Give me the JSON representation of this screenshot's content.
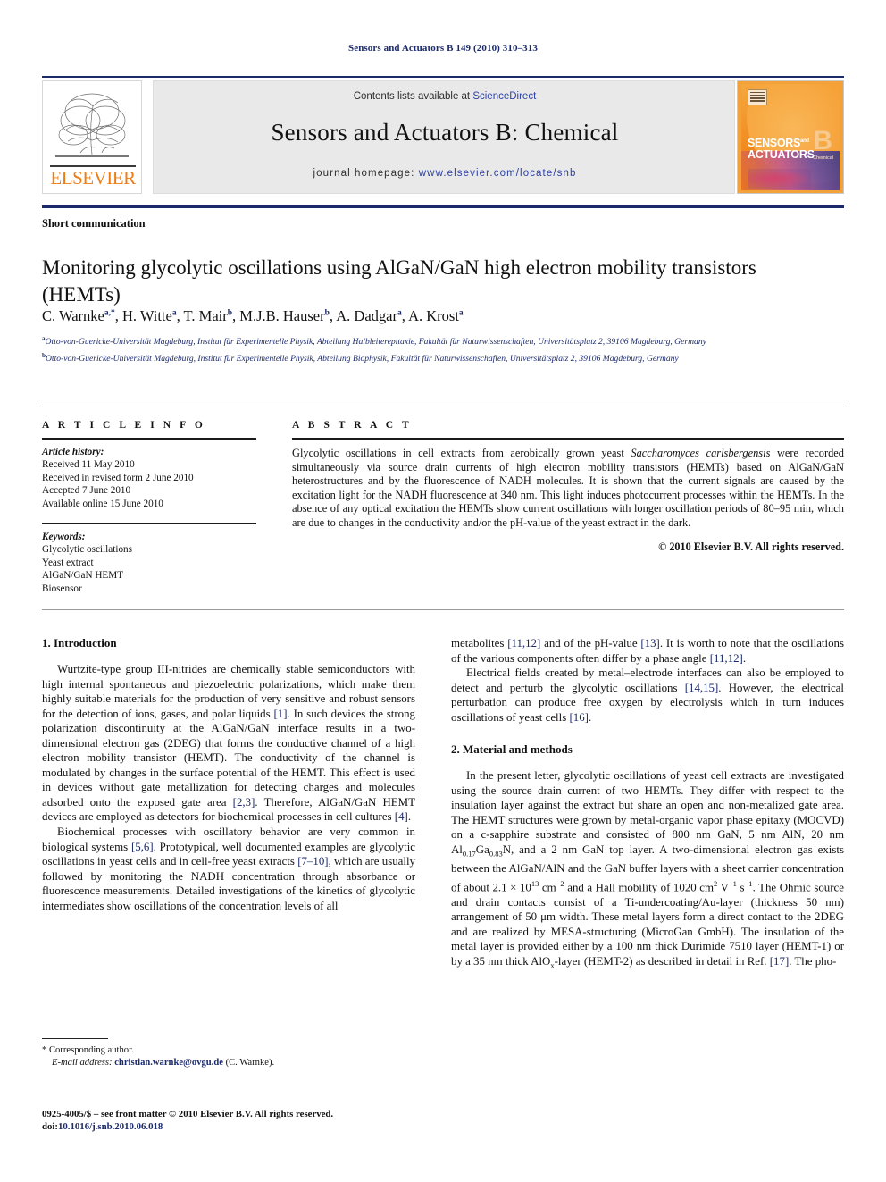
{
  "running_head": "Sensors and Actuators B 149 (2010) 310–313",
  "masthead": {
    "contents_prefix": "Contents lists available at ",
    "sciencedirect": "ScienceDirect",
    "journal_title": "Sensors and Actuators B: Chemical",
    "homepage_label": "journal homepage:",
    "homepage_url": "www.elsevier.com/locate/snb",
    "publisher_name": "ELSEVIER",
    "cover": {
      "line1": "SENSORS",
      "and": "and",
      "line2": "ACTUATORS",
      "letter": "B",
      "sublabel": "Chemical"
    },
    "accent_blue": "#1b2a6b",
    "link_blue": "#2c41a5",
    "elsevier_orange": "#ef7d15",
    "band_gray": "#e9e9e9"
  },
  "article": {
    "doctype": "Short communication",
    "title": "Monitoring glycolytic oscillations using AlGaN/GaN high electron mobility transistors (HEMTs)",
    "authors": [
      {
        "name": "C. Warnke",
        "sup": "a,*"
      },
      {
        "name": "H. Witte",
        "sup": "a"
      },
      {
        "name": "T. Mair",
        "sup": "b"
      },
      {
        "name": "M.J.B. Hauser",
        "sup": "b"
      },
      {
        "name": "A. Dadgar",
        "sup": "a"
      },
      {
        "name": "A. Krost",
        "sup": "a"
      }
    ],
    "affiliations": [
      {
        "mark": "a",
        "text": "Otto-von-Guericke-Universität Magdeburg, Institut für Experimentelle Physik, Abteilung Halbleiterepitaxie, Fakultät für Naturwissenschaften, Universitätsplatz 2, 39106 Magdeburg, Germany"
      },
      {
        "mark": "b",
        "text": "Otto-von-Guericke-Universität Magdeburg, Institut für Experimentelle Physik, Abteilung Biophysik, Fakultät für Naturwissenschaften, Universitätsplatz 2, 39106 Magdeburg, Germany"
      }
    ]
  },
  "article_info": {
    "heading": "A R T I C L E   I N F O",
    "history_label": "Article history:",
    "history": [
      "Received 11 May 2010",
      "Received in revised form 2 June 2010",
      "Accepted 7 June 2010",
      "Available online 15 June 2010"
    ],
    "keywords_label": "Keywords:",
    "keywords": [
      "Glycolytic oscillations",
      "Yeast extract",
      "AlGaN/GaN HEMT",
      "Biosensor"
    ]
  },
  "abstract": {
    "heading": "A B S T R A C T",
    "part1": "Glycolytic oscillations in cell extracts from aerobically grown yeast ",
    "species": "Saccharomyces carlsbergensis",
    "part2": " were recorded simultaneously via source drain currents of high electron mobility transistors (HEMTs) based on AlGaN/GaN heterostructures and by the fluorescence of NADH molecules. It is shown that the current signals are caused by the excitation light for the NADH fluorescence at 340 nm. This light induces photocurrent processes within the HEMTs. In the absence of any optical excitation the HEMTs show current oscillations with longer oscillation periods of 80–95 min, which are due to changes in the conductivity and/or the pH-value of the yeast extract in the dark.",
    "copyright": "© 2010 Elsevier B.V. All rights reserved."
  },
  "body": {
    "left": {
      "heading1": "1.  Introduction",
      "p1_a": "Wurtzite-type group III-nitrides are chemically stable semiconductors with high internal spontaneous and piezoelectric polarizations, which make them highly suitable materials for the production of very sensitive and robust sensors for the detection of ions, gases, and polar liquids ",
      "p1_r1": "[1]",
      "p1_b": ". In such devices the strong polarization discontinuity at the AlGaN/GaN interface results in a two-dimensional electron gas (2DEG) that forms the conductive channel of a high electron mobility transistor (HEMT). The conductivity of the channel is modulated by changes in the surface potential of the HEMT. This effect is used in devices without gate metallization for detecting charges and molecules adsorbed onto the exposed gate area ",
      "p1_r2": "[2,3]",
      "p1_c": ". Therefore, AlGaN/GaN HEMT devices are employed as detectors for biochemical processes in cell cultures ",
      "p1_r3": "[4]",
      "p1_d": ".",
      "p2_a": "Biochemical processes with oscillatory behavior are very common in biological systems ",
      "p2_r1": "[5,6]",
      "p2_b": ". Prototypical, well documented examples are glycolytic oscillations in yeast cells and in cell-free yeast extracts ",
      "p2_r2": "[7–10]",
      "p2_c": ", which are usually followed by monitoring the NADH concentration through absorbance or fluorescence measurements. Detailed investigations of the kinetics of glycolytic intermediates show oscillations of the concentration levels of all"
    },
    "right": {
      "p1_a": "metabolites ",
      "p1_r1": "[11,12]",
      "p1_b": " and of the pH-value ",
      "p1_r2": "[13]",
      "p1_c": ". It is worth to note that the oscillations of the various components often differ by a phase angle ",
      "p1_r3": "[11,12]",
      "p1_d": ".",
      "p2_a": "Electrical fields created by metal–electrode interfaces can also be employed to detect and perturb the glycolytic oscillations ",
      "p2_r1": "[14,15]",
      "p2_b": ". However, the electrical perturbation can produce free oxygen by electrolysis which in turn induces oscillations of yeast cells ",
      "p2_r2": "[16]",
      "p2_c": ".",
      "heading2": "2.  Material and methods",
      "p3_a": "In the present letter, glycolytic oscillations of yeast cell extracts are investigated using the source drain current of two HEMTs. They differ with respect to the insulation layer against the extract but share an open and non-metalized gate area. The HEMT structures were grown by metal-organic vapor phase epitaxy (MOCVD) on a c-sapphire substrate and consisted of 800 nm GaN, 5 nm AlN, 20 nm Al",
      "p3_sub1": "0.17",
      "p3_b": "Ga",
      "p3_sub2": "0.83",
      "p3_c": "N, and a 2 nm GaN top layer. A two-dimensional electron gas exists between the AlGaN/AlN and the GaN buffer layers with a sheet carrier concentration of about 2.1 × 10",
      "p3_sup1": "13",
      "p3_d": " cm",
      "p3_sup2": "−2",
      "p3_e": " and a Hall mobility of 1020 cm",
      "p3_sup3": "2",
      "p3_f": " V",
      "p3_sup4": "−1",
      "p3_g": " s",
      "p3_sup5": "−1",
      "p3_h": ". The Ohmic source and drain contacts consist of a Ti-undercoating/Au-layer (thickness 50 nm) arrangement of 50 μm width. These metal layers form a direct contact to the 2DEG and are realized by MESA-structuring (MicroGan GmbH). The insulation of the metal layer is provided either by a 100 nm thick Durimide 7510 layer (HEMT-1) or by a 35 nm thick AlO",
      "p3_subx": "x",
      "p3_i": "-layer (HEMT-2) as described in detail in Ref. ",
      "p3_r1": "[17]",
      "p3_j": ". The pho-"
    }
  },
  "footnote": {
    "star": "*",
    "corresponding": " Corresponding author.",
    "email_label": "E-mail address:",
    "email": "christian.warnke@ovgu.de",
    "email_suffix": " (C. Warnke)."
  },
  "footer": {
    "issn_line": "0925-4005/$ – see front matter © 2010 Elsevier B.V. All rights reserved.",
    "doi_label": "doi:",
    "doi": "10.1016/j.snb.2010.06.018"
  }
}
